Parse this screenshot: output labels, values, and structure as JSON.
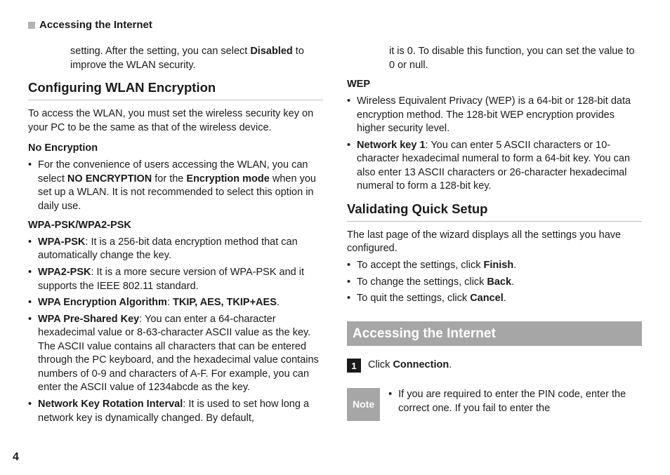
{
  "header": {
    "crumb": "Accessing the Internet"
  },
  "pageNumber": "4",
  "left": {
    "continuation": {
      "pre": "setting. After the setting, you can select ",
      "bold": "Disabled",
      "post": " to improve the WLAN security."
    },
    "section1": {
      "title": "Configuring WLAN Encryption",
      "intro": "To access the WLAN, you must set the wireless security key on your PC to be the same as that of the wireless device.",
      "noenc": {
        "heading": "No Encryption",
        "li1_pre": "For the convenience of users accessing the WLAN, you can select ",
        "li1_b1": "NO ENCRYPTION",
        "li1_mid": " for the ",
        "li1_b2": "Encryption mode",
        "li1_post": " when you set up a WLAN. It is not recommended to select this option in daily use."
      },
      "wpa": {
        "heading": "WPA-PSK/WPA2-PSK",
        "li1_b": "WPA-PSK",
        "li1_t": ": It is a 256-bit data encryption method that can automatically change the key.",
        "li2_b": "WPA2-PSK",
        "li2_t": ": It is a more secure version of WPA-PSK and it supports the IEEE 802.11 standard.",
        "li3_b": "WPA Encryption Algorithm",
        "li3_mid": ": ",
        "li3_b2": "TKIP, AES, TKIP+AES",
        "li3_post": ".",
        "li4_b": "WPA Pre-Shared Key",
        "li4_t": ": You can enter a 64-character hexadecimal value or 8-63-character ASCII value as the key. The ASCII value contains all characters that can be entered through the PC keyboard, and the hexadecimal value contains numbers of 0-9 and characters of A-F. For example, you can enter the ASCII value of 1234abcde as the key.",
        "li5_b": "Network Key Rotation Interval",
        "li5_t": ": It is used to set how long a network key is dynamically changed. By default,"
      }
    }
  },
  "right": {
    "continuation": "it is 0. To disable this function, you can set the value to 0 or null.",
    "wep": {
      "heading": "WEP",
      "li1": "Wireless Equivalent Privacy (WEP) is a 64-bit or 128-bit data encryption method. The 128-bit WEP encryption provides higher security level.",
      "li2_b": "Network key 1",
      "li2_t": ": You can enter 5 ASCII characters or 10-character hexadecimal numeral to form a 64-bit key. You can also enter 13 ASCII characters or 26-character hexadecimal numeral to form a 128-bit key."
    },
    "validate": {
      "title": "Validating Quick Setup",
      "intro": "The last page of the wizard displays all the settings you have configured.",
      "li1_pre": "To accept the settings, click ",
      "li1_b": "Finish",
      "li1_post": ".",
      "li2_pre": "To change the settings, click ",
      "li2_b": "Back",
      "li2_post": ".",
      "li3_pre": "To quit the settings, click ",
      "li3_b": "Cancel",
      "li3_post": "."
    },
    "access": {
      "title": "Accessing the Internet",
      "step1_num": "1",
      "step1_pre": "Click ",
      "step1_b": "Connection",
      "step1_post": ".",
      "note_label": "Note",
      "note_li1": "If you are required to enter the PIN code, enter the correct one. If you fail to enter the"
    }
  }
}
